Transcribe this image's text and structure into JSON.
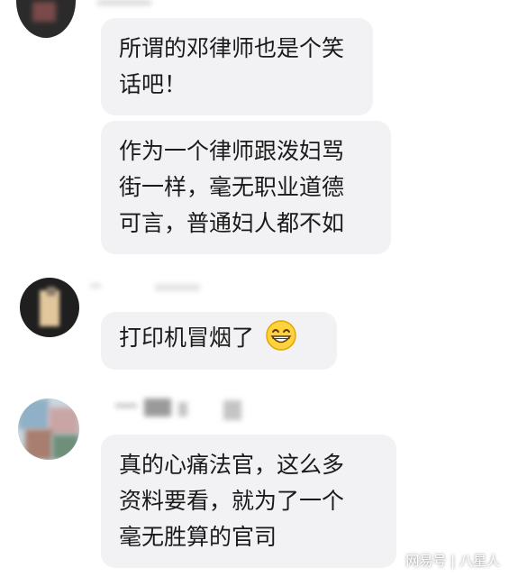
{
  "messages": [
    {
      "lines": [
        "所谓的邓律师也是个笑",
        "话吧！"
      ]
    },
    {
      "lines": [
        "作为一个律师跟泼妇骂",
        "街一样，毫无职业道德",
        "可言，普通妇人都不如"
      ]
    },
    {
      "lines": [
        "打印机冒烟了"
      ],
      "emoji": "grinning-face-icon"
    },
    {
      "lines": [
        "真的心痛法官，这么多",
        "资料要看，就为了一个",
        "毫无胜算的官司"
      ]
    }
  ],
  "watermark": {
    "source": "网易号",
    "separator": "|",
    "author": "八星人"
  },
  "colors": {
    "bubble": "#f2f2f4",
    "text": "#1a1a1a",
    "background": "#ffffff"
  }
}
